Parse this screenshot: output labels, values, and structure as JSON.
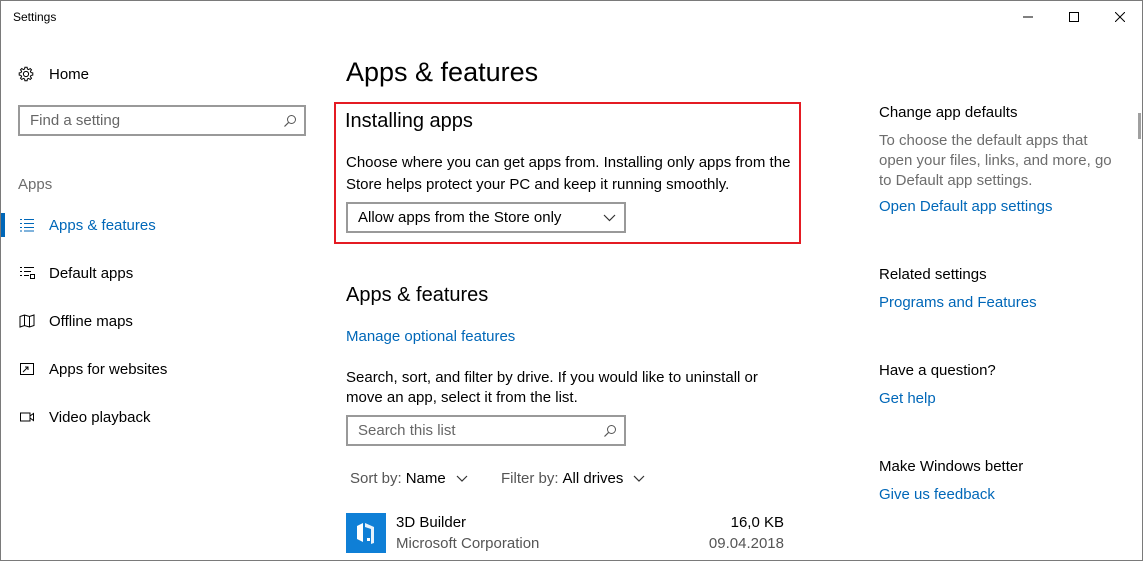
{
  "window": {
    "title": "Settings"
  },
  "sidebar": {
    "home_label": "Home",
    "search_placeholder": "Find a setting",
    "section_label": "Apps",
    "items": [
      {
        "label": "Apps & features",
        "icon": "list-icon",
        "active": true
      },
      {
        "label": "Default apps",
        "icon": "default-apps-icon",
        "active": false
      },
      {
        "label": "Offline maps",
        "icon": "map-icon",
        "active": false
      },
      {
        "label": "Apps for websites",
        "icon": "open-external-icon",
        "active": false
      },
      {
        "label": "Video playback",
        "icon": "video-icon",
        "active": false
      }
    ]
  },
  "main": {
    "title": "Apps & features",
    "installing": {
      "heading": "Installing apps",
      "description_line1": "Choose where you can get apps from. Installing only apps from the",
      "description_line2": "Store helps protect your PC and keep it running smoothly.",
      "dropdown_value": "Allow apps from the Store only"
    },
    "features": {
      "heading": "Apps & features",
      "manage_link": "Manage optional features",
      "description_line1": "Search, sort, and filter by drive. If you would like to uninstall or",
      "description_line2": "move an app, select it from the list.",
      "search_placeholder": "Search this list",
      "sort_label": "Sort by:",
      "sort_value": "Name",
      "filter_label": "Filter by:",
      "filter_value": "All drives"
    },
    "apps": [
      {
        "name": "3D Builder",
        "publisher": "Microsoft Corporation",
        "size": "16,0 KB",
        "date": "09.04.2018"
      }
    ]
  },
  "right": {
    "change_defaults": {
      "heading": "Change app defaults",
      "line1": "To choose the default apps that",
      "line2": "open your files, links, and more, go",
      "line3": "to Default app settings.",
      "link": "Open Default app settings"
    },
    "related": {
      "heading": "Related settings",
      "link": "Programs and Features"
    },
    "question": {
      "heading": "Have a question?",
      "link": "Get help"
    },
    "better": {
      "heading": "Make Windows better",
      "link": "Give us feedback"
    }
  },
  "colors": {
    "accent": "#0067b8",
    "highlight_border": "#e41b23",
    "app_tile": "#0f7fd6"
  }
}
